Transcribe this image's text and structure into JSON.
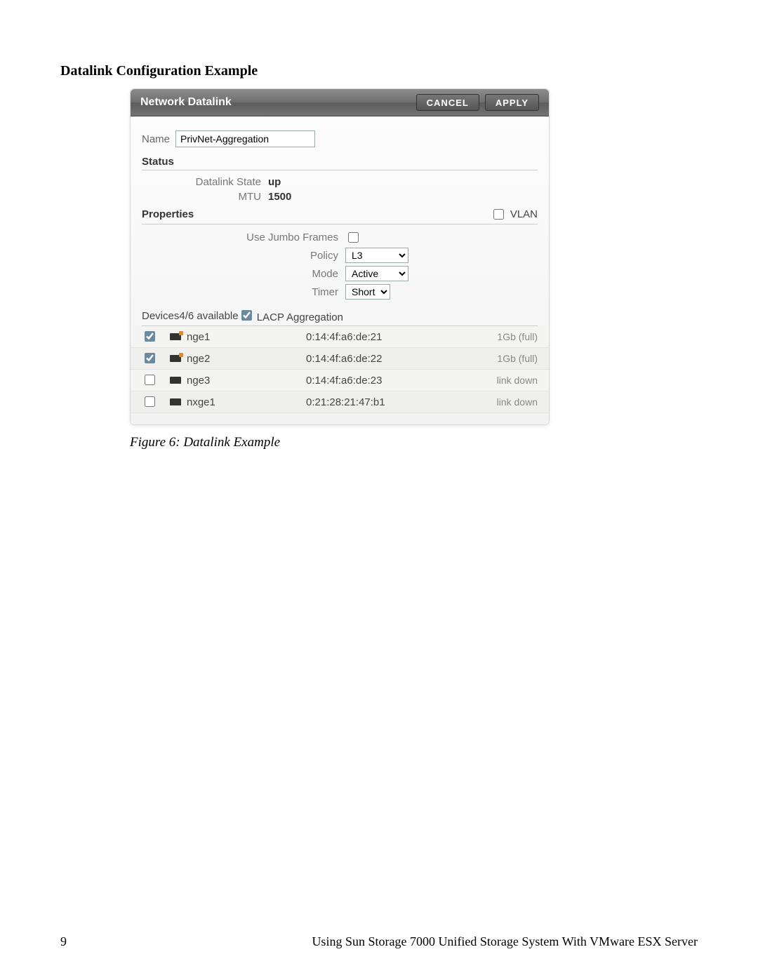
{
  "page": {
    "section_title": "Datalink Configuration Example",
    "figure_caption": "Figure 6: Datalink Example",
    "page_number": "9",
    "footer_text": "Using Sun Storage 7000 Unified Storage System With VMware ESX Server"
  },
  "dialog": {
    "title": "Network Datalink",
    "cancel_label": "CANCEL",
    "apply_label": "APPLY",
    "name_label": "Name",
    "name_value": "PrivNet-Aggregation",
    "status_header": "Status",
    "properties_header": "Properties",
    "devices_header": "Devices",
    "devices_note": "4/6 available",
    "vlan_label": "VLAN",
    "vlan_checked": false,
    "lacp_label": "LACP Aggregation",
    "lacp_checked": true,
    "status_rows": {
      "datalink_state_label": "Datalink State",
      "datalink_state_value": "up",
      "mtu_label": "MTU",
      "mtu_value": "1500"
    },
    "properties_rows": {
      "jumbo_label": "Use Jumbo Frames",
      "jumbo_checked": false,
      "policy_label": "Policy",
      "policy_value": "L3",
      "mode_label": "Mode",
      "mode_value": "Active",
      "timer_label": "Timer",
      "timer_value": "Short"
    },
    "devices": [
      {
        "checked": true,
        "up": true,
        "name": "nge1",
        "mac": "0:14:4f:a6:de:21",
        "status": "1Gb (full)"
      },
      {
        "checked": true,
        "up": true,
        "name": "nge2",
        "mac": "0:14:4f:a6:de:22",
        "status": "1Gb (full)"
      },
      {
        "checked": false,
        "up": false,
        "name": "nge3",
        "mac": "0:14:4f:a6:de:23",
        "status": "link down"
      },
      {
        "checked": false,
        "up": false,
        "name": "nxge1",
        "mac": "0:21:28:21:47:b1",
        "status": "link down"
      }
    ]
  }
}
